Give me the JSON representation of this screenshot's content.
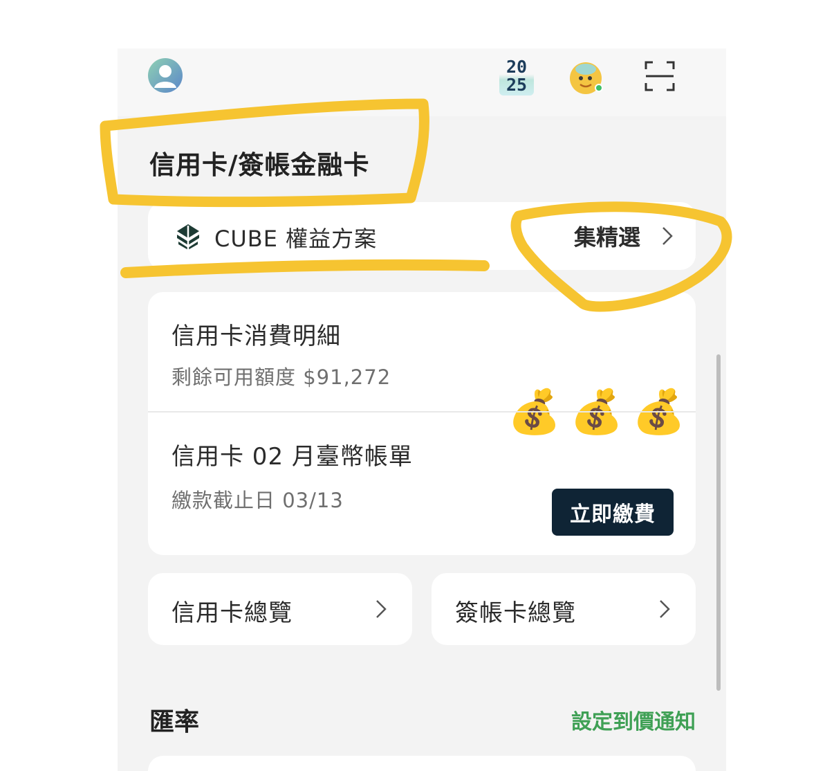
{
  "topbar": {
    "avatar_icon": "user-avatar-icon",
    "year_badge": {
      "line1": "20",
      "line2": "25"
    },
    "assistant_icon": "assistant-mascot-icon",
    "scan_icon": "scan-frame-icon"
  },
  "section": {
    "title": "信用卡/簽帳金融卡"
  },
  "cube": {
    "logo_icon": "cube-leaf-logo-icon",
    "label": "CUBE 權益方案",
    "link_label": "集精選"
  },
  "spending": {
    "title": "信用卡消費明細",
    "subtitle": "剩餘可用額度 $91,272",
    "emoji": [
      "💰",
      "💰",
      "💰"
    ]
  },
  "bill": {
    "title": "信用卡 02 月臺幣帳單",
    "subtitle": "繳款截止日 03/13",
    "pay_button": "立即繳費"
  },
  "overviews": [
    {
      "label": "信用卡總覽"
    },
    {
      "label": "簽帳卡總覽"
    }
  ],
  "exchange": {
    "title": "匯率",
    "link": "設定到價通知"
  },
  "colors": {
    "accent_green": "#3fa055",
    "pay_button_bg": "#0f2435",
    "annotation_yellow": "#f6c431",
    "background": "#f3f3f3"
  }
}
